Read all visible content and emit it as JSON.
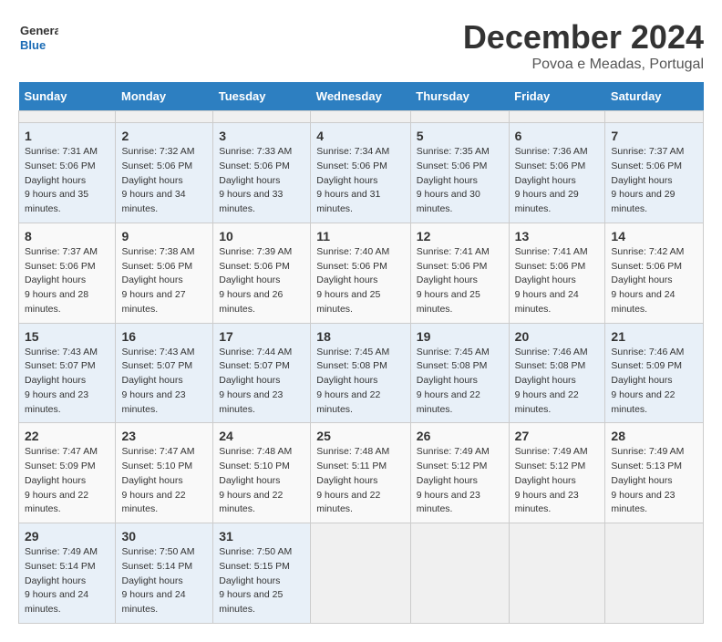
{
  "header": {
    "logo_line1": "General",
    "logo_line2": "Blue",
    "title": "December 2024",
    "subtitle": "Povoa e Meadas, Portugal"
  },
  "calendar": {
    "days_of_week": [
      "Sunday",
      "Monday",
      "Tuesday",
      "Wednesday",
      "Thursday",
      "Friday",
      "Saturday"
    ],
    "weeks": [
      [
        {
          "day": "",
          "empty": true
        },
        {
          "day": "",
          "empty": true
        },
        {
          "day": "",
          "empty": true
        },
        {
          "day": "",
          "empty": true
        },
        {
          "day": "",
          "empty": true
        },
        {
          "day": "",
          "empty": true
        },
        {
          "day": "",
          "empty": true
        }
      ],
      [
        {
          "num": "1",
          "sunrise": "7:31 AM",
          "sunset": "5:06 PM",
          "daylight": "9 hours and 35 minutes."
        },
        {
          "num": "2",
          "sunrise": "7:32 AM",
          "sunset": "5:06 PM",
          "daylight": "9 hours and 34 minutes."
        },
        {
          "num": "3",
          "sunrise": "7:33 AM",
          "sunset": "5:06 PM",
          "daylight": "9 hours and 33 minutes."
        },
        {
          "num": "4",
          "sunrise": "7:34 AM",
          "sunset": "5:06 PM",
          "daylight": "9 hours and 31 minutes."
        },
        {
          "num": "5",
          "sunrise": "7:35 AM",
          "sunset": "5:06 PM",
          "daylight": "9 hours and 30 minutes."
        },
        {
          "num": "6",
          "sunrise": "7:36 AM",
          "sunset": "5:06 PM",
          "daylight": "9 hours and 29 minutes."
        },
        {
          "num": "7",
          "sunrise": "7:37 AM",
          "sunset": "5:06 PM",
          "daylight": "9 hours and 29 minutes."
        }
      ],
      [
        {
          "num": "8",
          "sunrise": "7:37 AM",
          "sunset": "5:06 PM",
          "daylight": "9 hours and 28 minutes."
        },
        {
          "num": "9",
          "sunrise": "7:38 AM",
          "sunset": "5:06 PM",
          "daylight": "9 hours and 27 minutes."
        },
        {
          "num": "10",
          "sunrise": "7:39 AM",
          "sunset": "5:06 PM",
          "daylight": "9 hours and 26 minutes."
        },
        {
          "num": "11",
          "sunrise": "7:40 AM",
          "sunset": "5:06 PM",
          "daylight": "9 hours and 25 minutes."
        },
        {
          "num": "12",
          "sunrise": "7:41 AM",
          "sunset": "5:06 PM",
          "daylight": "9 hours and 25 minutes."
        },
        {
          "num": "13",
          "sunrise": "7:41 AM",
          "sunset": "5:06 PM",
          "daylight": "9 hours and 24 minutes."
        },
        {
          "num": "14",
          "sunrise": "7:42 AM",
          "sunset": "5:06 PM",
          "daylight": "9 hours and 24 minutes."
        }
      ],
      [
        {
          "num": "15",
          "sunrise": "7:43 AM",
          "sunset": "5:07 PM",
          "daylight": "9 hours and 23 minutes."
        },
        {
          "num": "16",
          "sunrise": "7:43 AM",
          "sunset": "5:07 PM",
          "daylight": "9 hours and 23 minutes."
        },
        {
          "num": "17",
          "sunrise": "7:44 AM",
          "sunset": "5:07 PM",
          "daylight": "9 hours and 23 minutes."
        },
        {
          "num": "18",
          "sunrise": "7:45 AM",
          "sunset": "5:08 PM",
          "daylight": "9 hours and 22 minutes."
        },
        {
          "num": "19",
          "sunrise": "7:45 AM",
          "sunset": "5:08 PM",
          "daylight": "9 hours and 22 minutes."
        },
        {
          "num": "20",
          "sunrise": "7:46 AM",
          "sunset": "5:08 PM",
          "daylight": "9 hours and 22 minutes."
        },
        {
          "num": "21",
          "sunrise": "7:46 AM",
          "sunset": "5:09 PM",
          "daylight": "9 hours and 22 minutes."
        }
      ],
      [
        {
          "num": "22",
          "sunrise": "7:47 AM",
          "sunset": "5:09 PM",
          "daylight": "9 hours and 22 minutes."
        },
        {
          "num": "23",
          "sunrise": "7:47 AM",
          "sunset": "5:10 PM",
          "daylight": "9 hours and 22 minutes."
        },
        {
          "num": "24",
          "sunrise": "7:48 AM",
          "sunset": "5:10 PM",
          "daylight": "9 hours and 22 minutes."
        },
        {
          "num": "25",
          "sunrise": "7:48 AM",
          "sunset": "5:11 PM",
          "daylight": "9 hours and 22 minutes."
        },
        {
          "num": "26",
          "sunrise": "7:49 AM",
          "sunset": "5:12 PM",
          "daylight": "9 hours and 23 minutes."
        },
        {
          "num": "27",
          "sunrise": "7:49 AM",
          "sunset": "5:12 PM",
          "daylight": "9 hours and 23 minutes."
        },
        {
          "num": "28",
          "sunrise": "7:49 AM",
          "sunset": "5:13 PM",
          "daylight": "9 hours and 23 minutes."
        }
      ],
      [
        {
          "num": "29",
          "sunrise": "7:49 AM",
          "sunset": "5:14 PM",
          "daylight": "9 hours and 24 minutes."
        },
        {
          "num": "30",
          "sunrise": "7:50 AM",
          "sunset": "5:14 PM",
          "daylight": "9 hours and 24 minutes."
        },
        {
          "num": "31",
          "sunrise": "7:50 AM",
          "sunset": "5:15 PM",
          "daylight": "9 hours and 25 minutes."
        },
        {
          "day": "",
          "empty": true
        },
        {
          "day": "",
          "empty": true
        },
        {
          "day": "",
          "empty": true
        },
        {
          "day": "",
          "empty": true
        }
      ]
    ],
    "labels": {
      "sunrise": "Sunrise:",
      "sunset": "Sunset:",
      "daylight": "Daylight hours"
    }
  }
}
